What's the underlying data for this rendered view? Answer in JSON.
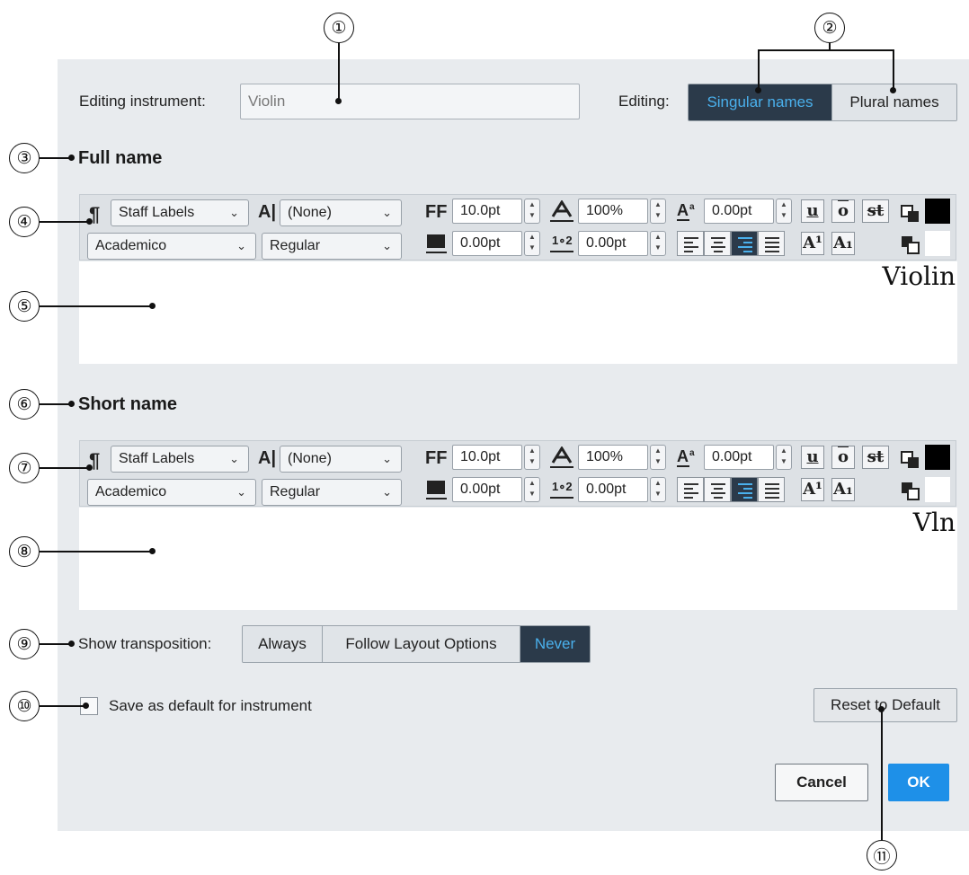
{
  "header": {
    "editing_instrument_label": "Editing instrument:",
    "instrument_value": "Violin",
    "editing_label": "Editing:",
    "tabs": [
      {
        "label": "Singular names",
        "active": true
      },
      {
        "label": "Plural names",
        "active": false
      }
    ]
  },
  "full_name": {
    "heading": "Full name",
    "toolbar": {
      "paragraph_style": "Staff Labels",
      "character_style": "(None)",
      "font": "Academico",
      "font_style": "Regular",
      "font_size": "10.0pt",
      "scale": "100%",
      "baseline": "0.00pt",
      "letter_spacing": "0.00pt",
      "leading": "0.00pt",
      "alignment": "right"
    },
    "preview": "Violin"
  },
  "short_name": {
    "heading": "Short name",
    "toolbar": {
      "paragraph_style": "Staff Labels",
      "character_style": "(None)",
      "font": "Academico",
      "font_style": "Regular",
      "font_size": "10.0pt",
      "scale": "100%",
      "baseline": "0.00pt",
      "letter_spacing": "0.00pt",
      "leading": "0.00pt",
      "alignment": "right"
    },
    "preview": "Vln"
  },
  "transposition": {
    "label": "Show transposition:",
    "options": [
      {
        "label": "Always",
        "active": false
      },
      {
        "label": "Follow Layout Options",
        "active": false
      },
      {
        "label": "Never",
        "active": true
      }
    ]
  },
  "save_default": {
    "label": "Save as default for instrument",
    "checked": false
  },
  "buttons": {
    "reset": "Reset to Default",
    "cancel": "Cancel",
    "ok": "OK"
  },
  "glyphs": {
    "paragraph": "¶",
    "char_style": "A|",
    "font_size": "FF",
    "chevron": "⌄",
    "underline": "u",
    "overline": "o",
    "strike": "st",
    "superscript": "A¹",
    "subscript": "A₁"
  },
  "callouts": [
    "①",
    "②",
    "③",
    "④",
    "⑤",
    "⑥",
    "⑦",
    "⑧",
    "⑨",
    "⑩",
    "⑪"
  ],
  "colors": {
    "panel_bg": "#e8ebee",
    "active_segment_bg": "#2b3a4a",
    "active_segment_text": "#4ab0ec",
    "ok_button": "#1e90e8",
    "fg_color_swatch": "#000000",
    "bg_color_swatch": "#ffffff"
  }
}
